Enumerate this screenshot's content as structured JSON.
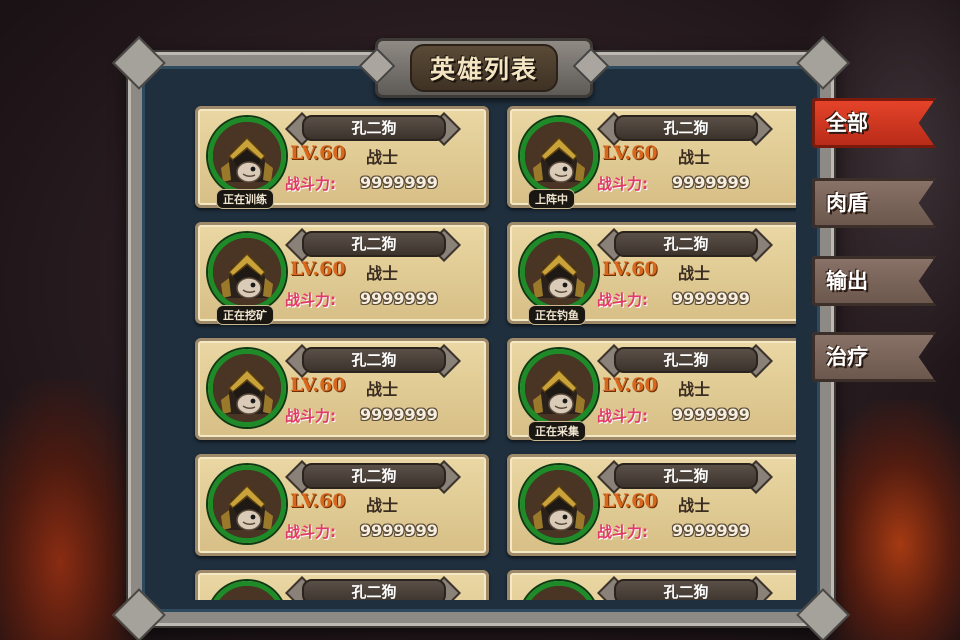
{
  "title": "英雄列表",
  "tabs": [
    {
      "label": "全部",
      "active": true
    },
    {
      "label": "肉盾",
      "active": false
    },
    {
      "label": "输出",
      "active": false
    },
    {
      "label": "治疗",
      "active": false
    }
  ],
  "power_label": "战斗力:",
  "heroes": [
    {
      "name": "孔二狗",
      "level": "LV.60",
      "class": "战士",
      "power": "9999999",
      "status": "正在训练"
    },
    {
      "name": "孔二狗",
      "level": "LV.60",
      "class": "战士",
      "power": "9999999",
      "status": "上阵中"
    },
    {
      "name": "孔二狗",
      "level": "LV.60",
      "class": "战士",
      "power": "9999999",
      "status": "正在挖矿"
    },
    {
      "name": "孔二狗",
      "level": "LV.60",
      "class": "战士",
      "power": "9999999",
      "status": "正在钓鱼"
    },
    {
      "name": "孔二狗",
      "level": "LV.60",
      "class": "战士",
      "power": "9999999",
      "status": ""
    },
    {
      "name": "孔二狗",
      "level": "LV.60",
      "class": "战士",
      "power": "9999999",
      "status": "正在采集"
    },
    {
      "name": "孔二狗",
      "level": "LV.60",
      "class": "战士",
      "power": "9999999",
      "status": ""
    },
    {
      "name": "孔二狗",
      "level": "LV.60",
      "class": "战士",
      "power": "9999999",
      "status": ""
    },
    {
      "name": "孔二狗",
      "level": "",
      "class": "",
      "power": "",
      "status": ""
    },
    {
      "name": "孔二狗",
      "level": "",
      "class": "",
      "power": "",
      "status": ""
    }
  ],
  "colors": {
    "active_tab": "#d63a22",
    "inactive_tab": "#7a655a",
    "avatar_ring": "#1e8a28",
    "level_text": "#d8661c",
    "power_label": "#e13a68"
  },
  "icons": {
    "avatar": "helmeted-warrior-portrait-icon"
  }
}
